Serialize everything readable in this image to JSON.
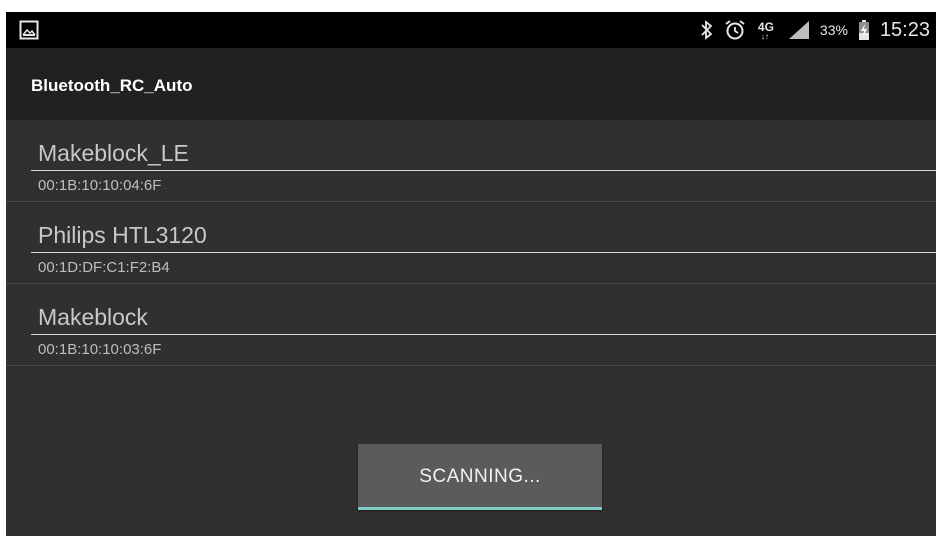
{
  "status_bar": {
    "battery_percent": "33%",
    "time": "15:23",
    "network_type": "4G",
    "network_arrows": "↓↑",
    "icons": [
      "gallery-icon",
      "bluetooth-icon",
      "alarm-icon",
      "signal-icon",
      "battery-charging-icon"
    ]
  },
  "app": {
    "title": "Bluetooth_RC_Auto"
  },
  "devices": [
    {
      "name": "Makeblock_LE",
      "address": "00:1B:10:10:04:6F"
    },
    {
      "name": "Philips HTL3120",
      "address": "00:1D:DF:C1:F2:B4"
    },
    {
      "name": "Makeblock",
      "address": "00:1B:10:10:03:6F"
    }
  ],
  "scan_button": {
    "label": "SCANNING..."
  },
  "colors": {
    "background": "#303030",
    "action_bar": "#212121",
    "status_bar": "#000000",
    "button": "#5b5b5b",
    "accent": "#80cbc4"
  }
}
